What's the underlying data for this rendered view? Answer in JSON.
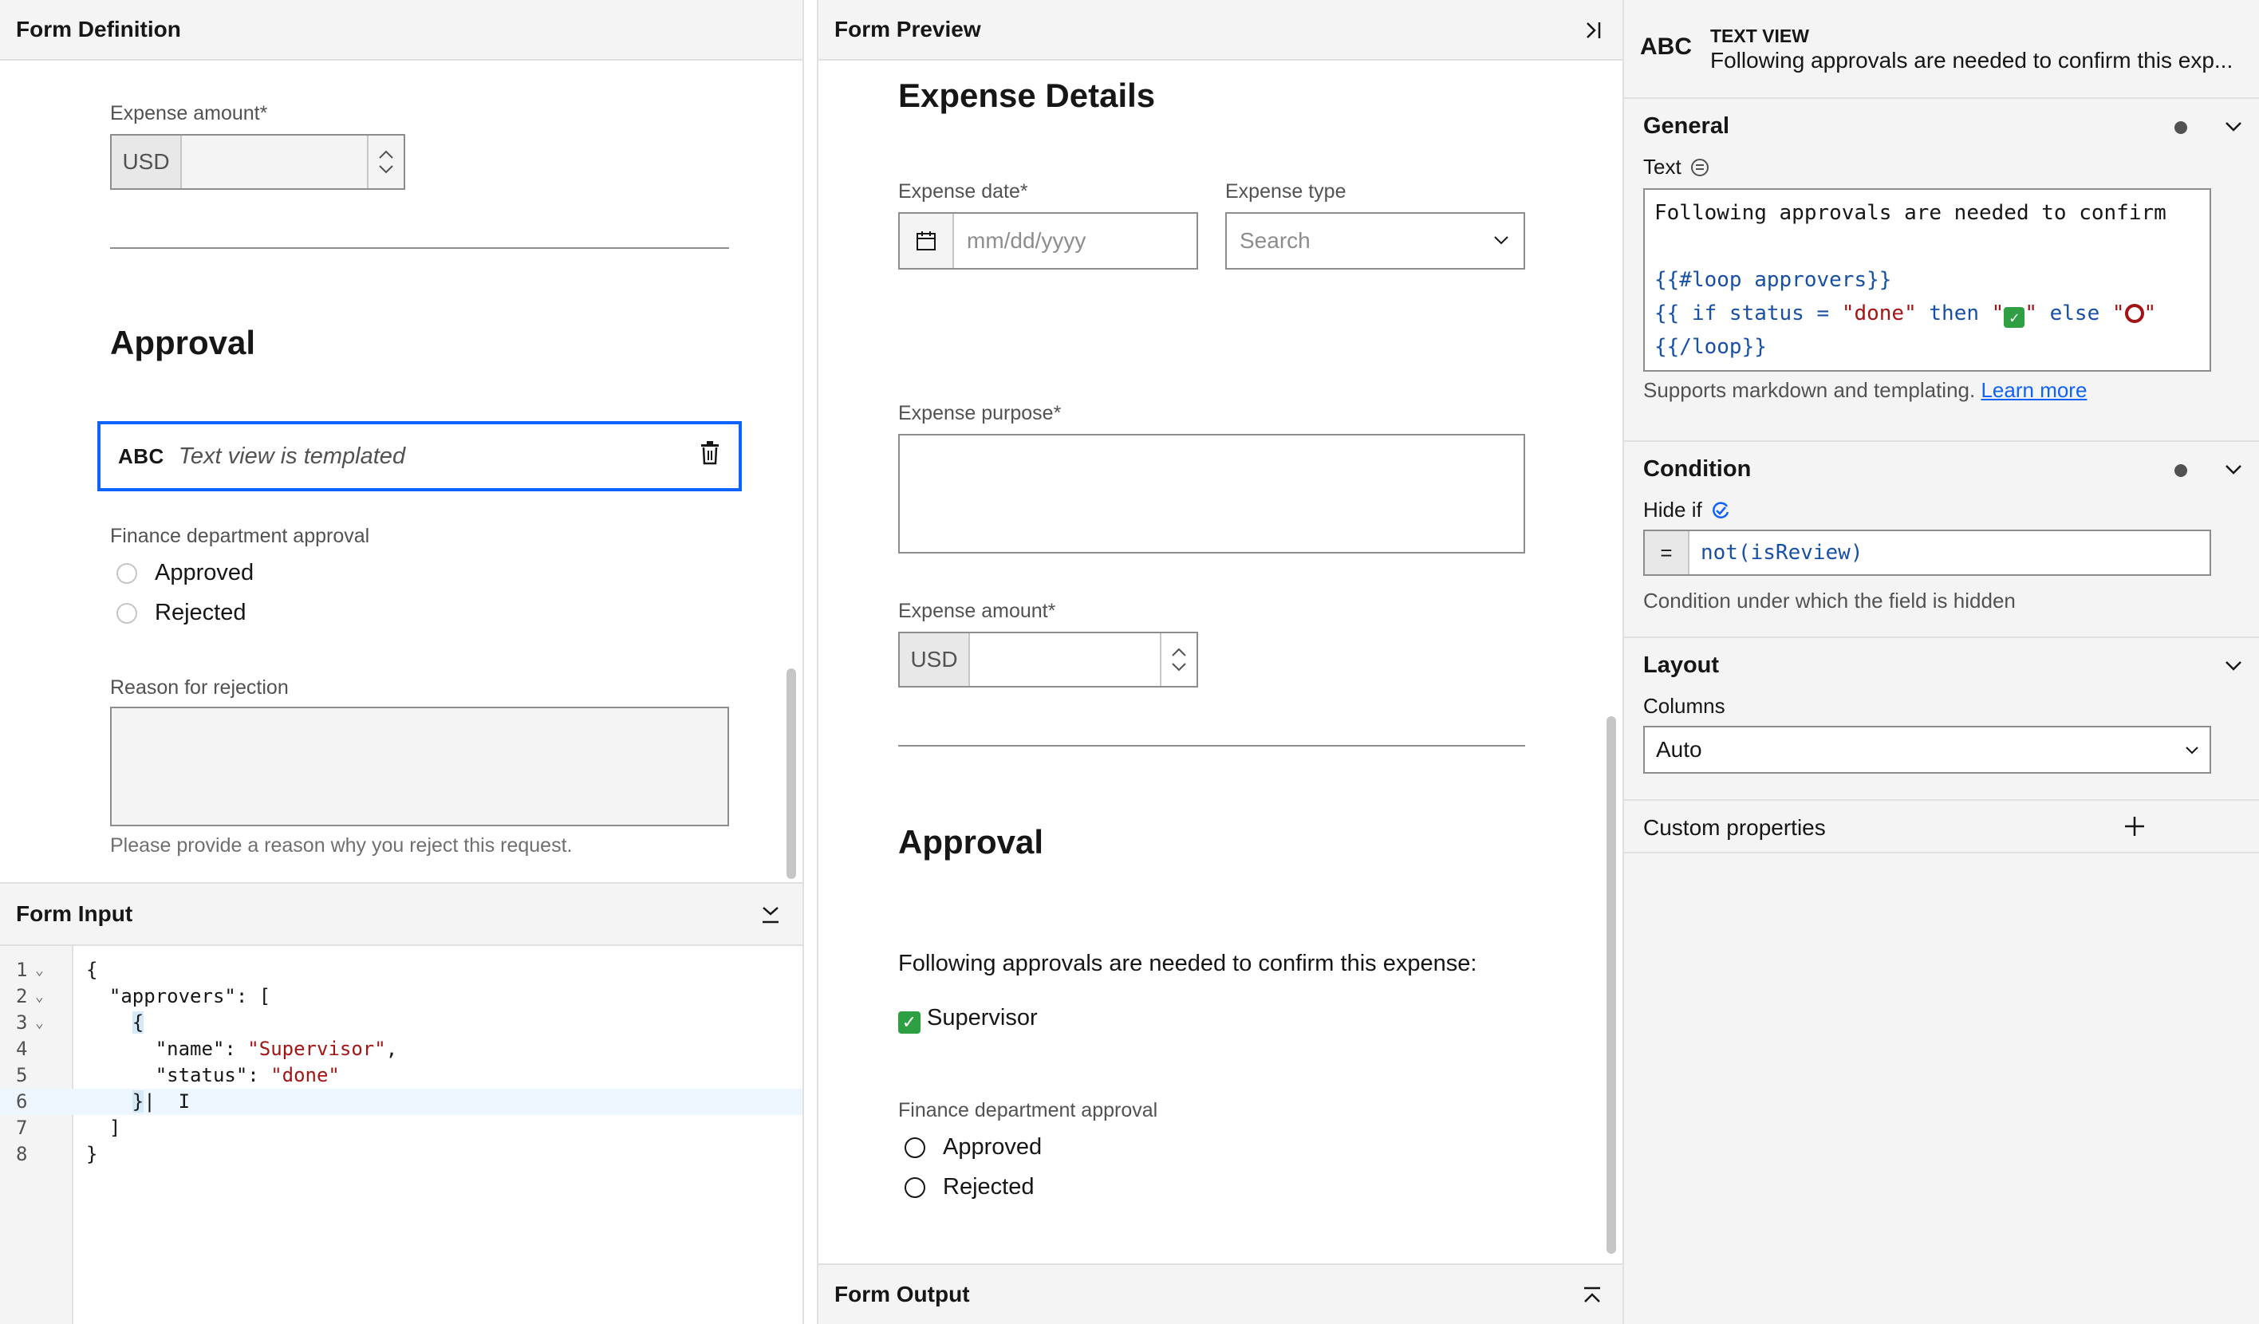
{
  "form_definition": {
    "title": "Form Definition",
    "expense_amount_label": "Expense amount*",
    "currency": "USD",
    "approval_heading": "Approval",
    "text_view": {
      "type_label": "ABC",
      "placeholder": "Text view is templated"
    },
    "finance_label": "Finance department approval",
    "radio_approved": "Approved",
    "radio_rejected": "Rejected",
    "reason_label": "Reason for rejection",
    "reason_helper": "Please provide a reason why you reject this request."
  },
  "form_input": {
    "title": "Form Input",
    "line_numbers": [
      "1",
      "2",
      "3",
      "4",
      "5",
      "6",
      "7",
      "8"
    ]
  },
  "form_preview": {
    "title": "Form Preview",
    "heading": "Expense Details",
    "expense_date_label": "Expense date*",
    "expense_date_placeholder": "mm/dd/yyyy",
    "expense_type_label": "Expense type",
    "expense_type_placeholder": "Search",
    "expense_purpose_label": "Expense purpose*",
    "expense_amount_label": "Expense amount*",
    "currency": "USD",
    "approval_heading": "Approval",
    "approvals_text": "Following approvals are needed to confirm this expense:",
    "approver_name": "Supervisor",
    "check_emoji": "✓",
    "finance_label": "Finance department approval",
    "radio_approved": "Approved",
    "radio_rejected": "Rejected"
  },
  "form_output": {
    "title": "Form Output"
  },
  "properties": {
    "type_abbrev": "ABC",
    "type_name": "TEXT VIEW",
    "subtitle": "Following approvals are needed to confirm this exp...",
    "general": {
      "title": "General",
      "text_label": "Text",
      "code_lines": [
        "Following approvals are needed to confirm",
        "",
        "{{#loop approvers}}",
        "{{ if status = \"done\" then \"✅\" else \"⭕\"",
        "{{/loop}}"
      ],
      "helper": "Supports markdown and templating.",
      "learn_more": "Learn more"
    },
    "condition": {
      "title": "Condition",
      "hide_if_label": "Hide if",
      "eq": "=",
      "expression": "not(isReview)",
      "helper": "Condition under which the field is hidden"
    },
    "layout": {
      "title": "Layout",
      "columns_label": "Columns",
      "columns_value": "Auto"
    },
    "custom": {
      "title": "Custom properties"
    }
  },
  "colors": {
    "accent": "#0f62fe",
    "string": "#a31515",
    "template": "#1750a5",
    "check": "#2ea043"
  }
}
